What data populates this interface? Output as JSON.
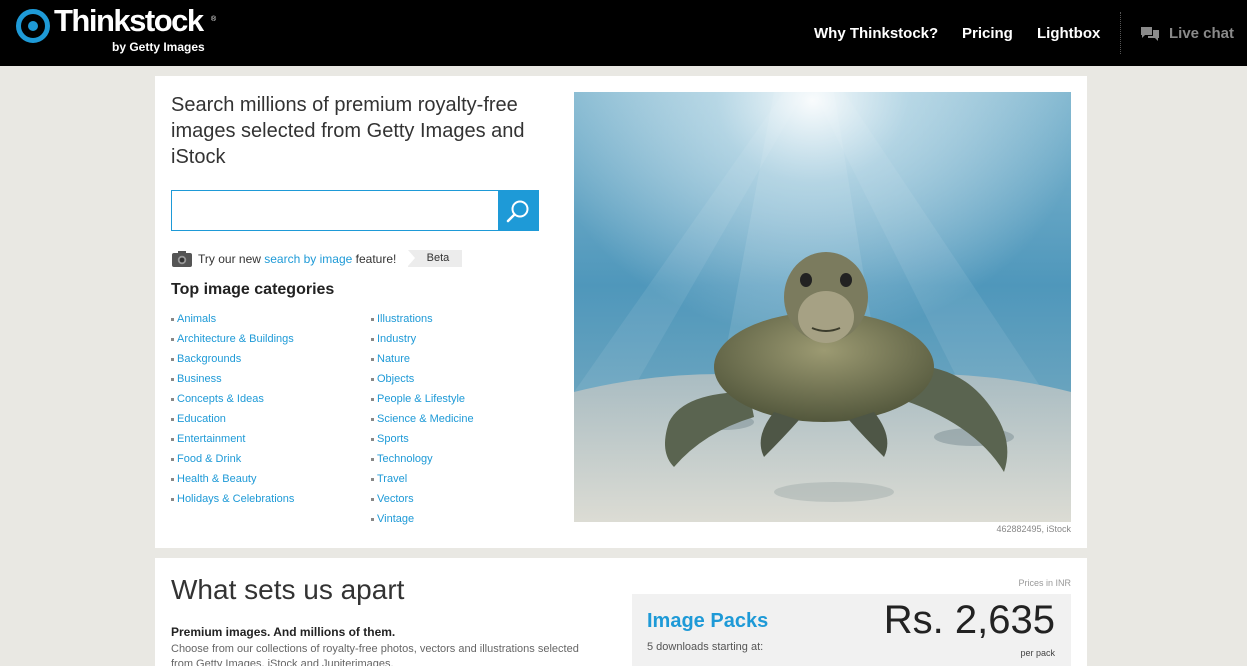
{
  "header": {
    "logo_name": "Thinkstock",
    "logo_reg": "®",
    "logo_sub": "by Getty Images",
    "nav": [
      "Why Thinkstock?",
      "Pricing",
      "Lightbox"
    ],
    "live_chat": "Live chat"
  },
  "hero": {
    "headline": "Search millions of premium royalty-free images selected from Getty Images and iStock",
    "search": {
      "value": "",
      "placeholder": ""
    },
    "by_image": {
      "prefix": "Try our new ",
      "link": "search by image",
      "suffix": " feature!",
      "badge": "Beta"
    },
    "categories_title": "Top image categories",
    "categories_left": [
      "Animals",
      "Architecture & Buildings",
      "Backgrounds",
      "Business",
      "Concepts & Ideas",
      "Education",
      "Entertainment",
      "Food & Drink",
      "Health & Beauty",
      "Holidays & Celebrations"
    ],
    "categories_right": [
      "Illustrations",
      "Industry",
      "Nature",
      "Objects",
      "People & Lifestyle",
      "Science & Medicine",
      "Sports",
      "Technology",
      "Travel",
      "Vectors",
      "Vintage"
    ],
    "photo_credit": "462882495, iStock"
  },
  "apart": {
    "title": "What sets us apart",
    "subtitle": "Premium images. And millions of them.",
    "text": "Choose from our collections of royalty-free photos, vectors and illustrations selected from Getty Images, iStock and Jupiterimages.",
    "prices_note": "Prices in INR",
    "packs_title": "Image Packs",
    "packs_sub": "5 downloads starting at:",
    "packs_price": "Rs. 2,635",
    "packs_per": "per pack"
  },
  "colors": {
    "accent": "#1e9ad7",
    "topbar": "#000000",
    "page_bg": "#e9e8e3"
  }
}
